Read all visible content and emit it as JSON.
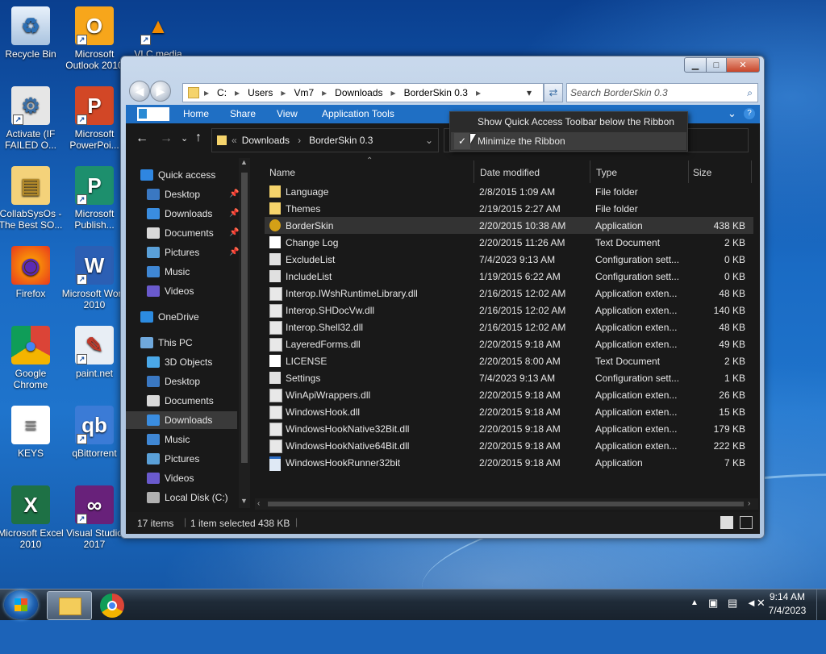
{
  "desktop": {
    "icons": [
      {
        "label": "Recycle Bin"
      },
      {
        "label": "Microsoft Outlook 2010"
      },
      {
        "label": "VLC media"
      },
      {
        "label": "Activate (IF FAILED O..."
      },
      {
        "label": "Microsoft PowerPoi..."
      },
      {
        "label": "CollabSysOs - The Best SO..."
      },
      {
        "label": "Microsoft Publish..."
      },
      {
        "label": "Firefox"
      },
      {
        "label": "Microsoft Word 2010"
      },
      {
        "label": "Google Chrome"
      },
      {
        "label": "paint.net"
      },
      {
        "label": "KEYS"
      },
      {
        "label": "qBittorrent"
      },
      {
        "label": "Microsoft Excel 2010"
      },
      {
        "label": "Visual Studio 2017"
      }
    ]
  },
  "window": {
    "address_parts": [
      "C:",
      "Users",
      "Vm7",
      "Downloads",
      "BorderSkin 0.3"
    ],
    "search_placeholder": "Search BorderSkin 0.3",
    "caption": {
      "minimize": "▁",
      "maximize": "□",
      "close": "✕"
    }
  },
  "ribbon": {
    "tabs": [
      "Home",
      "Share",
      "View",
      "Application Tools"
    ]
  },
  "context_menu": {
    "items": [
      {
        "label": "Show Quick Access Toolbar below the Ribbon",
        "checked": false
      },
      {
        "label": "Minimize the Ribbon",
        "checked": true
      }
    ]
  },
  "breadcrumb": {
    "prefix": "«",
    "parts": [
      "Downloads",
      "BorderSkin 0.3"
    ]
  },
  "sidebar": {
    "quick_access": "Quick access",
    "quick_items": [
      {
        "label": "Desktop",
        "pinned": true
      },
      {
        "label": "Downloads",
        "pinned": true
      },
      {
        "label": "Documents",
        "pinned": true
      },
      {
        "label": "Pictures",
        "pinned": true
      },
      {
        "label": "Music",
        "pinned": false
      },
      {
        "label": "Videos",
        "pinned": false
      }
    ],
    "onedrive": "OneDrive",
    "this_pc": "This PC",
    "pc_items": [
      "3D Objects",
      "Desktop",
      "Documents",
      "Downloads",
      "Music",
      "Pictures",
      "Videos",
      "Local Disk (C:)"
    ]
  },
  "columns": {
    "name": "Name",
    "date": "Date modified",
    "type": "Type",
    "size": "Size"
  },
  "files": [
    {
      "name": "Language",
      "date": "2/8/2015 1:09 AM",
      "type": "File folder",
      "size": "",
      "icon": "folder"
    },
    {
      "name": "Themes",
      "date": "2/19/2015 2:27 AM",
      "type": "File folder",
      "size": "",
      "icon": "folder"
    },
    {
      "name": "BorderSkin",
      "date": "2/20/2015 10:38 AM",
      "type": "Application",
      "size": "438 KB",
      "icon": "app"
    },
    {
      "name": "Change Log",
      "date": "2/20/2015 11:26 AM",
      "type": "Text Document",
      "size": "2 KB",
      "icon": "text"
    },
    {
      "name": "ExcludeList",
      "date": "7/4/2023 9:13 AM",
      "type": "Configuration sett...",
      "size": "0 KB",
      "icon": "config"
    },
    {
      "name": "IncludeList",
      "date": "1/19/2015 6:22 AM",
      "type": "Configuration sett...",
      "size": "0 KB",
      "icon": "config"
    },
    {
      "name": "Interop.IWshRuntimeLibrary.dll",
      "date": "2/16/2015 12:02 AM",
      "type": "Application exten...",
      "size": "48 KB",
      "icon": "dll"
    },
    {
      "name": "Interop.SHDocVw.dll",
      "date": "2/16/2015 12:02 AM",
      "type": "Application exten...",
      "size": "140 KB",
      "icon": "dll"
    },
    {
      "name": "Interop.Shell32.dll",
      "date": "2/16/2015 12:02 AM",
      "type": "Application exten...",
      "size": "48 KB",
      "icon": "dll"
    },
    {
      "name": "LayeredForms.dll",
      "date": "2/20/2015 9:18 AM",
      "type": "Application exten...",
      "size": "49 KB",
      "icon": "dll"
    },
    {
      "name": "LICENSE",
      "date": "2/20/2015 8:00 AM",
      "type": "Text Document",
      "size": "2 KB",
      "icon": "text"
    },
    {
      "name": "Settings",
      "date": "7/4/2023 9:13 AM",
      "type": "Configuration sett...",
      "size": "1 KB",
      "icon": "config"
    },
    {
      "name": "WinApiWrappers.dll",
      "date": "2/20/2015 9:18 AM",
      "type": "Application exten...",
      "size": "26 KB",
      "icon": "dll"
    },
    {
      "name": "WindowsHook.dll",
      "date": "2/20/2015 9:18 AM",
      "type": "Application exten...",
      "size": "15 KB",
      "icon": "dll"
    },
    {
      "name": "WindowsHookNative32Bit.dll",
      "date": "2/20/2015 9:18 AM",
      "type": "Application exten...",
      "size": "179 KB",
      "icon": "dll"
    },
    {
      "name": "WindowsHookNative64Bit.dll",
      "date": "2/20/2015 9:18 AM",
      "type": "Application exten...",
      "size": "222 KB",
      "icon": "dll"
    },
    {
      "name": "WindowsHookRunner32bit",
      "date": "2/20/2015 9:18 AM",
      "type": "Application",
      "size": "7 KB",
      "icon": "exe"
    }
  ],
  "selected_file": "BorderSkin",
  "status": {
    "count": "17 items",
    "selection": "1 item selected",
    "size": "438 KB"
  },
  "taskbar": {
    "time": "9:14 AM",
    "date": "7/4/2023"
  }
}
